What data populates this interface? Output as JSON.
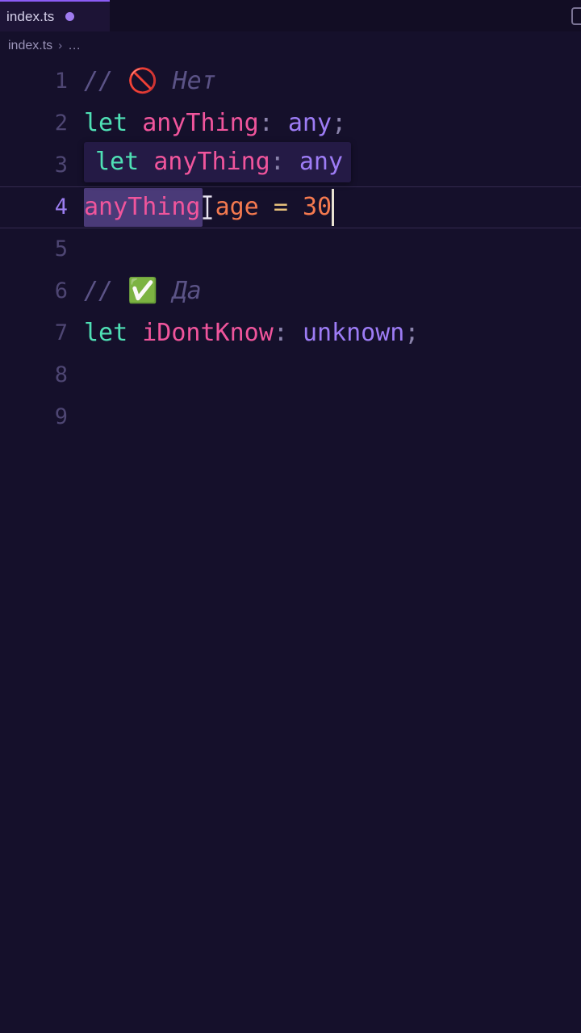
{
  "window": {
    "background": "#15102b"
  },
  "tabbar": {
    "tab_label": "index.ts",
    "dirty_indicator": "modified-dot",
    "layout_icon": "split-editor-icon"
  },
  "breadcrumb": {
    "file": "index.ts",
    "separator": "›",
    "ellipsis": "…"
  },
  "editor": {
    "active_line": 4,
    "gutter": [
      "1",
      "2",
      "3",
      "4",
      "5",
      "6",
      "7",
      "8",
      "9"
    ],
    "lines": [
      {
        "number": "1",
        "tokens": [
          {
            "text": "// ",
            "cls": "t-comment"
          },
          {
            "text": "🚫",
            "cls": "emoji"
          },
          {
            "text": " Нет",
            "cls": "t-comment"
          }
        ]
      },
      {
        "number": "2",
        "tokens": [
          {
            "text": "let ",
            "cls": "t-kw"
          },
          {
            "text": "anyThing",
            "cls": "t-var"
          },
          {
            "text": ": ",
            "cls": "t-punct"
          },
          {
            "text": "any",
            "cls": "t-type"
          },
          {
            "text": ";",
            "cls": "t-punct"
          }
        ]
      },
      {
        "number": "3",
        "tokens": []
      },
      {
        "number": "4",
        "tokens": [
          {
            "text": "anyThing",
            "cls": "t-var"
          },
          {
            "text": ".",
            "cls": "t-punct"
          },
          {
            "text": "age",
            "cls": "t-prop"
          },
          {
            "text": " ",
            "cls": "t-punct"
          },
          {
            "text": "=",
            "cls": "t-op"
          },
          {
            "text": " ",
            "cls": "t-punct"
          },
          {
            "text": "30",
            "cls": "t-num"
          }
        ]
      },
      {
        "number": "5",
        "tokens": []
      },
      {
        "number": "6",
        "tokens": [
          {
            "text": "// ",
            "cls": "t-comment"
          },
          {
            "text": "✅",
            "cls": "emoji"
          },
          {
            "text": " Да",
            "cls": "t-comment"
          }
        ]
      },
      {
        "number": "7",
        "tokens": [
          {
            "text": "let ",
            "cls": "t-kw"
          },
          {
            "text": "iDontKnow",
            "cls": "t-var"
          },
          {
            "text": ": ",
            "cls": "t-punct"
          },
          {
            "text": "unknown",
            "cls": "t-type"
          },
          {
            "text": ";",
            "cls": "t-punct"
          }
        ]
      },
      {
        "number": "8",
        "tokens": []
      },
      {
        "number": "9",
        "tokens": []
      }
    ],
    "suggestion_widget": {
      "visible": true,
      "tokens": [
        {
          "text": "let ",
          "cls": "t-kw"
        },
        {
          "text": "anyThing",
          "cls": "t-var"
        },
        {
          "text": ": ",
          "cls": "t-punct"
        },
        {
          "text": "any",
          "cls": "t-type"
        }
      ]
    },
    "occurrence_highlight_word": "anyThing",
    "mouse_cursor": "text-ibeam"
  },
  "colors": {
    "background": "#15102b",
    "tab_active_bg": "#1d1436",
    "tab_accent": "#8b5cf6",
    "gutter_text": "#4e4673",
    "gutter_active_text": "#9b7df0",
    "keyword": "#4fe0b5",
    "variable": "#f0559c",
    "type": "#9d7cf5",
    "comment": "#5b5386",
    "property": "#f4794f",
    "number": "#f4794f",
    "operator": "#e6c07b",
    "punctuation": "#8a83ab",
    "selection_highlight": "#4a3a78",
    "suggest_bg": "#241a45",
    "caret": "#e8e2d2"
  }
}
